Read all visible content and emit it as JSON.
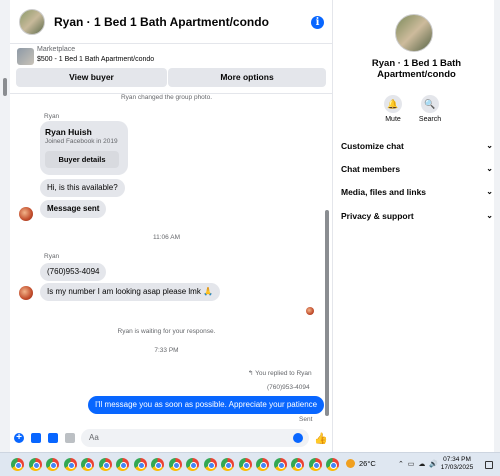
{
  "header": {
    "title": "Ryan · 1 Bed 1 Bath Apartment/condo",
    "info_glyph": "i"
  },
  "listing": {
    "category": "Marketplace",
    "price_title": "$500 - 1 Bed 1 Bath Apartment/condo",
    "view_buyer": "View buyer",
    "more_options": "More options"
  },
  "messages": {
    "photo_changed": "Ryan changed the group photo.",
    "sender1": "Ryan",
    "card_name": "Ryan Huish",
    "card_joined": "Joined Facebook in 2019",
    "card_button": "Buyer details",
    "msg_available": "Hi, is this available?",
    "msg_sent": "Message sent",
    "time1": "11:06 AM",
    "sender2": "Ryan",
    "msg_phone": "(760)953-4094",
    "msg_number": "Is my number I am looking asap please lmk 🙏",
    "waiting": "Ryan is waiting for your response.",
    "time2": "7:33 PM",
    "replied_to": "You replied to Ryan",
    "quoted_phone": "(760)953-4094",
    "msg_out": "I'll message you as soon as possible. Appreciate your patience",
    "status": "Sent"
  },
  "composer": {
    "placeholder": "Aa"
  },
  "panel": {
    "name": "Ryan · 1 Bed 1 Bath Apartment/condo",
    "mute": "Mute",
    "search": "Search",
    "rows": [
      "Customize chat",
      "Chat members",
      "Media, files and links",
      "Privacy & support"
    ]
  },
  "taskbar": {
    "temperature": "26°C",
    "time": "07:34 PM",
    "date": "17/03/2025",
    "app_icon": "chrome-icon",
    "app_count": 19
  },
  "colors": {
    "accent": "#0866ff",
    "bubble_in": "#e4e6eb"
  }
}
